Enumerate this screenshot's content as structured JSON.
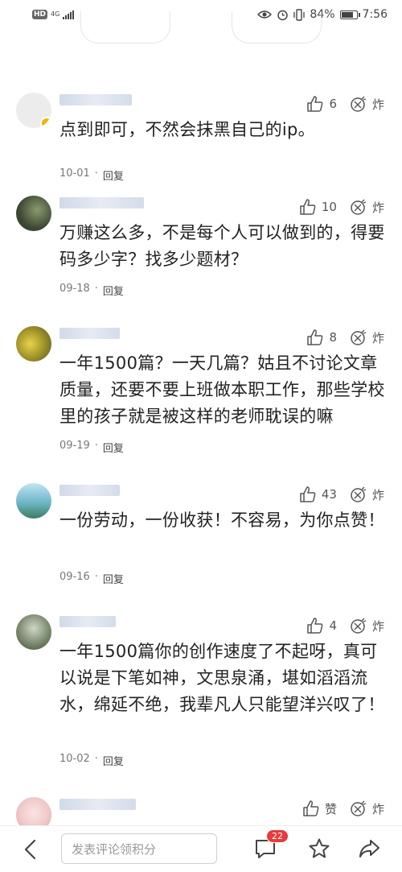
{
  "status_bar": {
    "hd": "HD",
    "network": "4G",
    "battery_text": "84%",
    "battery_level": 0.84,
    "time": "7:56"
  },
  "comments": [
    {
      "text": "点到即可，不然会抹黑自己的ip。",
      "likes": "6",
      "bomb": "炸",
      "date": "10-01",
      "reply": "回复",
      "avatar_color": "#e9e9e9",
      "verified": true
    },
    {
      "text": "万赚这么多，不是每个人可以做到的，得要码多少字？找多少题材？",
      "likes": "10",
      "bomb": "炸",
      "date": "09-18",
      "reply": "回复",
      "avatar_color": "#4a5a3a",
      "verified": false
    },
    {
      "text": "一年1500篇？一天几篇？姑且不讨论文章质量，还要不要上班做本职工作，那些学校里的孩子就是被这样的老师耽误的嘛",
      "likes": "8",
      "bomb": "炸",
      "date": "09-19",
      "reply": "回复",
      "avatar_color": "#b7a733",
      "verified": false
    },
    {
      "text": "一份劳动，一份收获！不容易，为你点赞！",
      "likes": "43",
      "bomb": "炸",
      "date": "09-16",
      "reply": "回复",
      "avatar_color": "#6fb6c9",
      "verified": false
    },
    {
      "text": "一年1500篇你的创作速度了不起呀，真可以说是下笔如神，文思泉涌，堪如滔滔流水，绵延不绝，我辈凡人只能望洋兴叹了！",
      "likes": "4",
      "bomb": "炸",
      "date": "10-02",
      "reply": "回复",
      "avatar_color": "#7c8a70",
      "verified": false
    },
    {
      "text": "",
      "likes": "赞",
      "bomb": "炸",
      "date": "",
      "reply": "",
      "avatar_color": "#f0c9c9",
      "verified": false
    }
  ],
  "bottom_bar": {
    "input_placeholder": "发表评论领积分",
    "comment_count": "22"
  }
}
